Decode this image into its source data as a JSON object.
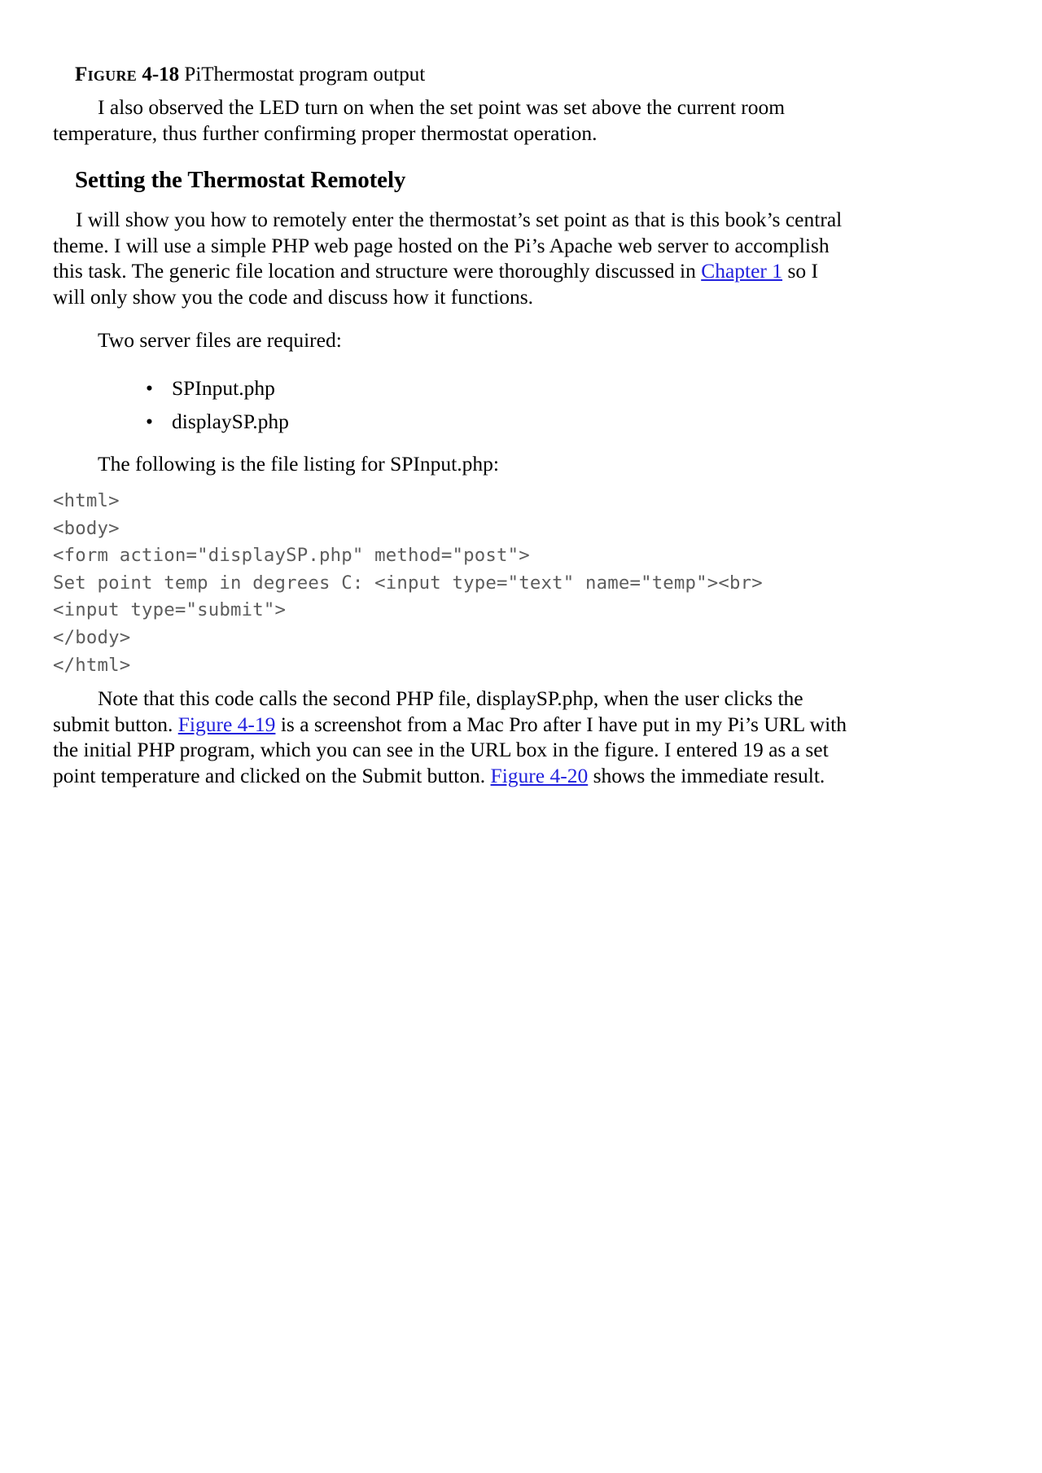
{
  "document": {
    "figure_caption": {
      "label": "Figure",
      "number": "4-18",
      "text": " PiThermostat program output"
    },
    "paragraph_led": "I also observed the LED turn on when the set point was set above the current room temperature, thus further confirming proper thermostat operation.",
    "section_heading": "Setting the Thermostat Remotely",
    "paragraph_intro": {
      "part1": "I will show you how to remotely enter the thermostat’s set point as that is this book’s central theme. I will use a simple PHP web page hosted on the Pi’s Apache web server to accomplish this task. The generic file location and structure were thoroughly discussed in ",
      "link_chapter1": "Chapter 1",
      "part2": " so I will only show you the code and discuss how it functions."
    },
    "lead_in_files": "Two server files are required:",
    "file_list": [
      {
        "bullet": "•",
        "label": "SPInput.php"
      },
      {
        "bullet": "•",
        "label": "displaySP.php"
      }
    ],
    "lead_in_listing": "The following is the file listing for SPInput.php:",
    "code_listing": "<html>\n<body>\n<form action=\"displaySP.php\" method=\"post\">\nSet point temp in degrees C: <input type=\"text\" name=\"temp\"><br>\n<input type=\"submit\">\n</body>\n</html>",
    "paragraph_note": {
      "part1": "Note that this code calls the second PHP file, displaySP.php, when the user clicks the submit button. ",
      "link_fig419": "Figure 4-19",
      "part2": " is a screenshot from a Mac Pro after I have put in my Pi’s URL with the initial PHP program, which you can see in the URL box in the figure. I entered 19 as a set point temperature and clicked on the Submit button. ",
      "link_fig420": "Figure 4-20",
      "part3": " shows the immediate result."
    }
  },
  "colors": {
    "page_background": "#ffffff",
    "text": "#000000",
    "link": "#2222dd",
    "code_text": "#5c5c5c"
  }
}
